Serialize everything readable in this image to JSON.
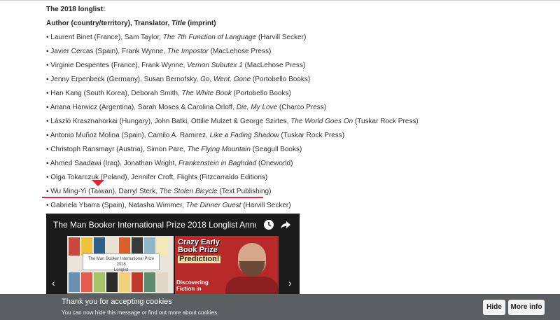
{
  "longlist": {
    "heading": "The 2018 longlist:",
    "legend_prefix": "Author (country/territory), Translator, ",
    "legend_title": "Title",
    "legend_suffix": " (imprint)",
    "entries": [
      {
        "pre": "• Laurent Binet (France), Sam Taylor, ",
        "title": "The 7th Function of Language",
        "post": " (Harvill Secker)"
      },
      {
        "pre": "• Javier Cercas (Spain), Frank Wynne, ",
        "title": "The Impostor",
        "post": " (MacLehose Press)"
      },
      {
        "pre": "• Virginie Despentes (France), Frank Wynne, ",
        "title": "Vernon Subutex 1",
        "post": " (MacLehose Press)"
      },
      {
        "pre": "• Jenny Erpenbeck (Germany), Susan Bernofsky, ",
        "title": "Go, Went, Gone",
        "post": " (Portobello Books)"
      },
      {
        "pre": "• Han Kang (South Korea), Deborah Smith, ",
        "title": "The White Book",
        "post": " (Portobello Books)"
      },
      {
        "pre": "• Ariana Harwicz (Argentina), Sarah Moses & Carolina Orloff, ",
        "title": "Die, My Love",
        "post": " (Charco Press)"
      },
      {
        "pre": "• László Krasznahorkai (Hungary), John Batki, Ottilie Mulzet & George Szirtes, ",
        "title": "The World Goes On",
        "post": " (Tuskar Rock Press)"
      },
      {
        "pre": "• Antonio Muñoz Molina (Spain), Camilo A. Ramirez, ",
        "title": "Like a Fading Shadow",
        "post": " (Tuskar Rock Press)"
      },
      {
        "pre": "• Christoph Ransmayr (Austria), Simon Pare, ",
        "title": "The Flying Mountain",
        "post": " (Seagull Books)"
      },
      {
        "pre": "• Ahmed Saadawi (Iraq), Jonathan Wright, ",
        "title": "Frankenstein in Baghdad",
        "post": " (Oneworld)"
      },
      {
        "pre": "• Olga Tokarczuk (Poland), Jennifer Croft, Flights (Fitzcarraldo Editions)",
        "title": "",
        "post": ""
      },
      {
        "pre": "• Wu Ming-Yi (Taiwan), Darryl Sterk, ",
        "title": "The Stolen Bicycle",
        "post": " (Text Publishing)"
      },
      {
        "pre": "• Gabriela Ybarra (Spain), Natasha Wimmer, ",
        "title": "The Dinner Guest",
        "post": " (Harvill Secker)"
      }
    ]
  },
  "video": {
    "title": "The Man Booker International Prize 2018 Longlist Anno...",
    "thumb_banner_line1": "The Man Booker International Prize 2018",
    "thumb_banner_line2": "Longlist",
    "crazy_line1": "Crazy Early",
    "crazy_line2": "Book Prize",
    "crazy_line3": "Prediction!",
    "bottom_line1": "Discovering",
    "bottom_line2": "Fiction in",
    "prev_arrow": "‹",
    "next_arrow": "›"
  },
  "cookie": {
    "title": "Thank you for accepting cookies",
    "text": "You can now hide this message or find out more about cookies.",
    "hide_label": "Hide",
    "more_label": "More info"
  },
  "colors": {
    "highlight": "#e3242b",
    "cookie_bg": "#5c5f61"
  }
}
